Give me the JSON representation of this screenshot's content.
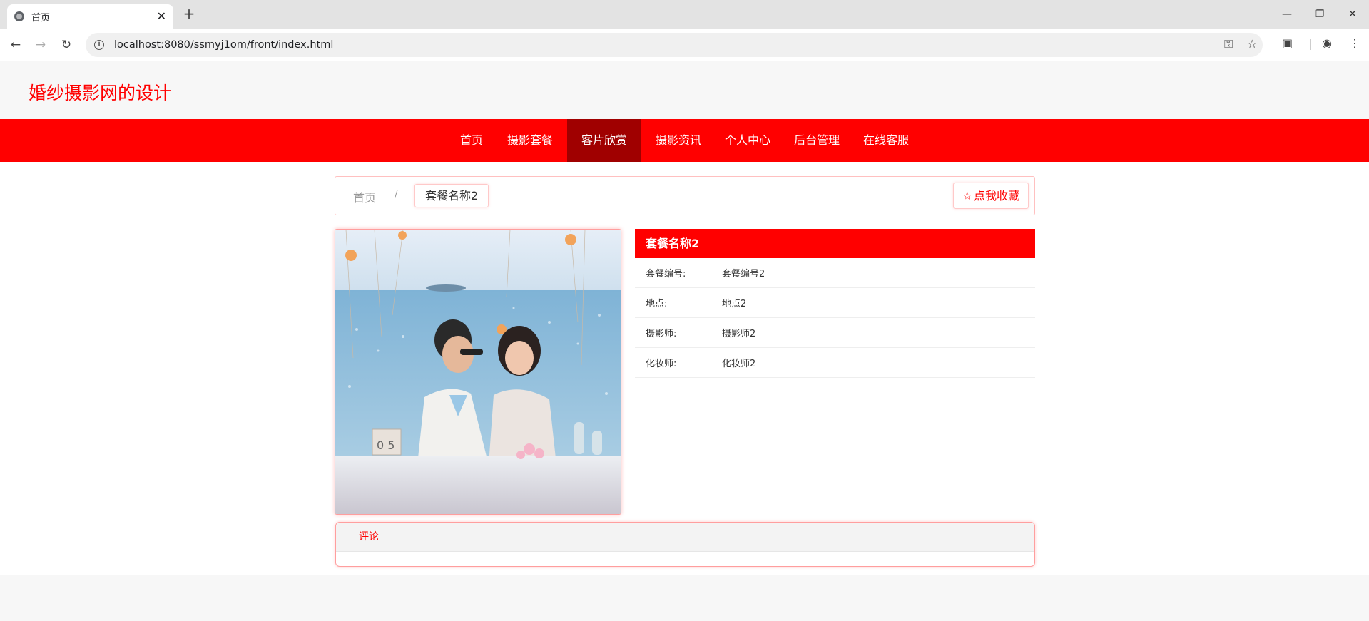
{
  "browser": {
    "tab_title": "首页",
    "tab_close": "✕",
    "new_tab": "+",
    "url": "localhost:8080/ssmyj1om/front/index.html",
    "window_controls": {
      "minimize": "—",
      "restore": "❐",
      "close": "✕"
    }
  },
  "site": {
    "title": "婚纱摄影网的设计",
    "nav": [
      {
        "label": "首页"
      },
      {
        "label": "摄影套餐"
      },
      {
        "label": "客片欣赏",
        "active": true
      },
      {
        "label": "摄影资讯"
      },
      {
        "label": "个人中心"
      },
      {
        "label": "后台管理"
      },
      {
        "label": "在线客服"
      }
    ]
  },
  "breadcrumb": {
    "home": "首页",
    "separator": "/",
    "current": "套餐名称2"
  },
  "favorite": {
    "icon": "star-outline-icon",
    "label": "点我收藏"
  },
  "package": {
    "name": "套餐名称2",
    "fields": [
      {
        "label": "套餐编号:",
        "value": "套餐编号2"
      },
      {
        "label": "地点:",
        "value": "地点2"
      },
      {
        "label": "摄影师:",
        "value": "摄影师2"
      },
      {
        "label": "化妆师:",
        "value": "化妆师2"
      }
    ]
  },
  "comments": {
    "tab_label": "评论"
  },
  "colors": {
    "brand": "#ff0000",
    "nav_active": "#a00000",
    "border_pink": "#ff9e9e"
  }
}
